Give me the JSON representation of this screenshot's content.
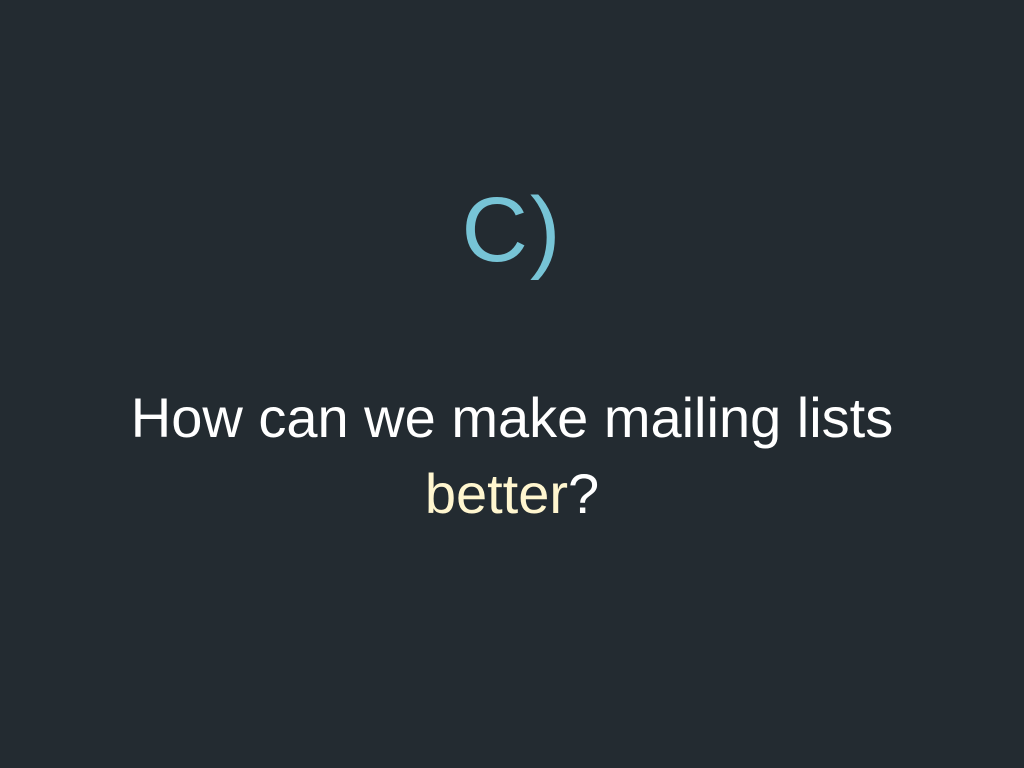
{
  "slide": {
    "marker": "C)",
    "question_line1": "How can we make mailing lists",
    "question_word": "better",
    "question_mark": "?"
  },
  "colors": {
    "background": "#232b31",
    "marker": "#77c4d6",
    "question_text": "#ffffff",
    "highlight": "#fff6cf"
  }
}
